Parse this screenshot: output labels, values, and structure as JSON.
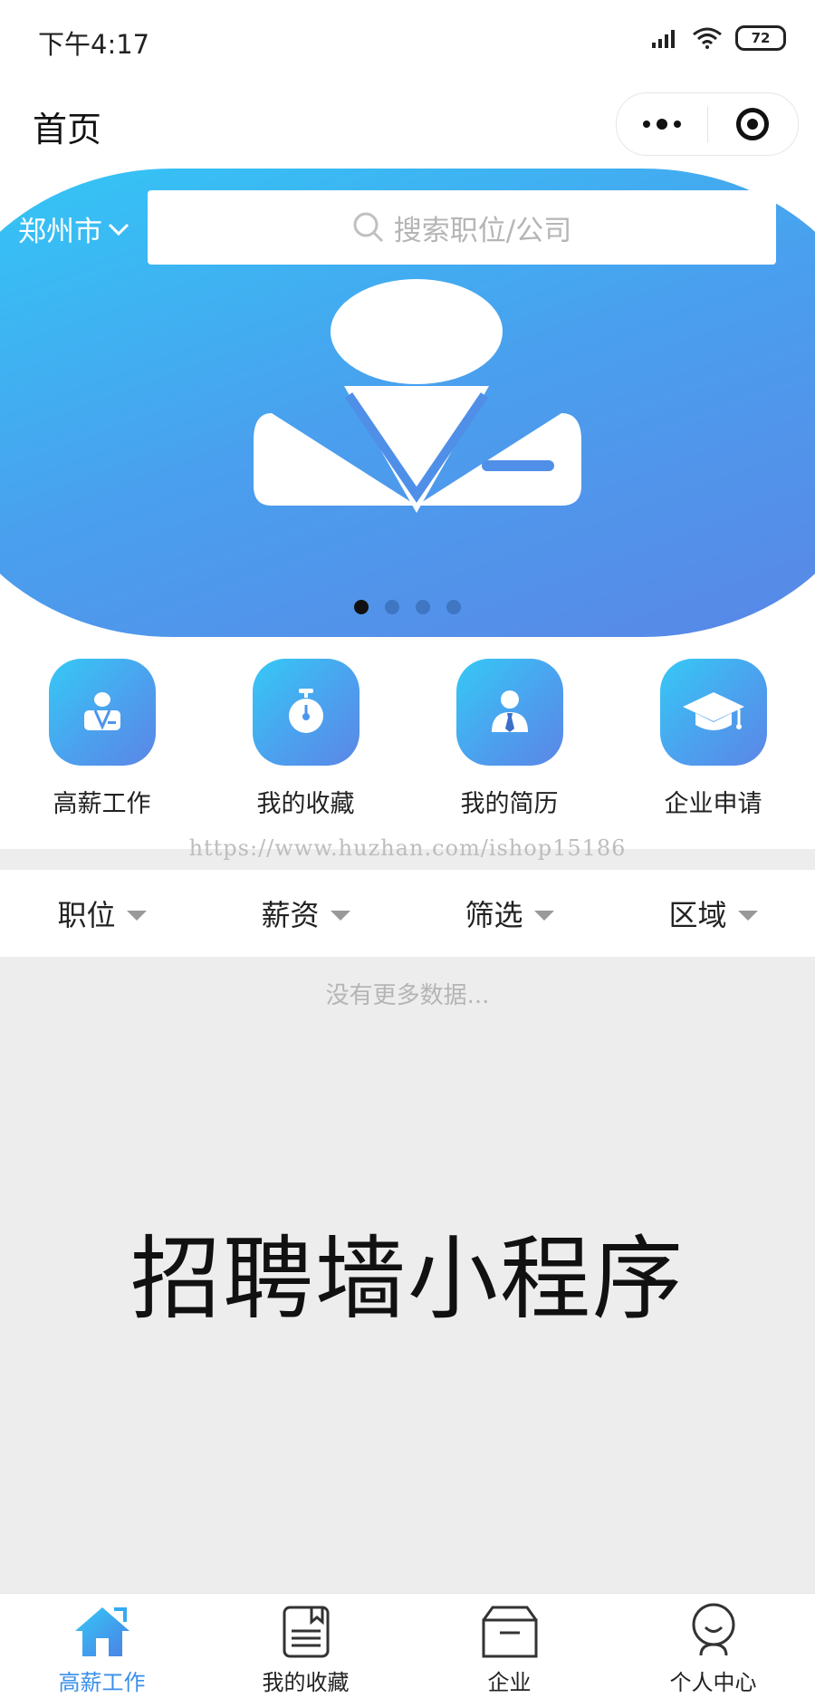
{
  "status_bar": {
    "time": "下午4:17",
    "battery": "72"
  },
  "nav": {
    "title": "首页"
  },
  "banner": {
    "city": "郑州市",
    "search_placeholder": "搜索职位/公司",
    "indicator_count": 4,
    "active_indicator": 0
  },
  "menu": [
    {
      "label": "高薪工作",
      "icon": "businessman-icon"
    },
    {
      "label": "我的收藏",
      "icon": "stopwatch-icon"
    },
    {
      "label": "我的简历",
      "icon": "person-tie-icon"
    },
    {
      "label": "企业申请",
      "icon": "graduation-cap-icon"
    }
  ],
  "watermark": "https://www.huzhan.com/ishop15186",
  "filters": [
    {
      "label": "职位"
    },
    {
      "label": "薪资"
    },
    {
      "label": "筛选"
    },
    {
      "label": "区域"
    }
  ],
  "list": {
    "empty_text": "没有更多数据..."
  },
  "headline": "招聘墙小程序",
  "tabbar": [
    {
      "label": "高薪工作",
      "icon": "home-icon",
      "active": true
    },
    {
      "label": "我的收藏",
      "icon": "bookmark-book-icon",
      "active": false
    },
    {
      "label": "企业",
      "icon": "box-icon",
      "active": false
    },
    {
      "label": "个人中心",
      "icon": "user-icon",
      "active": false
    }
  ],
  "colors": {
    "accent": "#3a8fea",
    "banner_start": "#32c8f6",
    "banner_end": "#5a86e6"
  }
}
